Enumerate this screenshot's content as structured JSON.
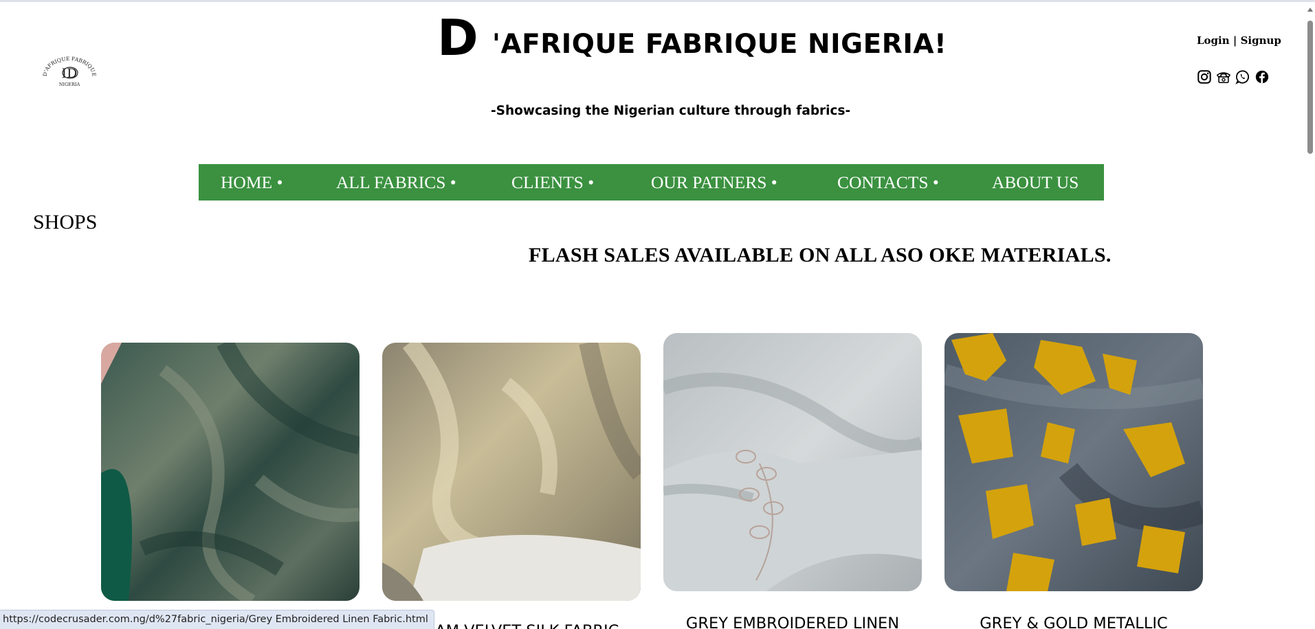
{
  "brand": {
    "initial": "D",
    "name": "'AFRIQUE FABRIQUE NIGERIA!",
    "tagline": "-Showcasing the Nigerian culture through fabrics-",
    "logo_text_top": "D'AFRIQUE FABRIQUE",
    "logo_text_bottom": "NIGERIA"
  },
  "auth": {
    "login": "Login",
    "separator": " | ",
    "signup": "Signup"
  },
  "socials": [
    {
      "icon": "instagram-icon"
    },
    {
      "icon": "telephone-icon"
    },
    {
      "icon": "whatsapp-icon"
    },
    {
      "icon": "facebook-icon"
    }
  ],
  "nav": {
    "background": "#3b9140",
    "items": [
      "HOME •",
      "ALL FABRICS •",
      "CLIENTS •",
      "OUR PATNERS •",
      "CONTACTS •",
      "ABOUT US"
    ]
  },
  "shops_heading": "SHOPS",
  "flash_banner": "FLASH SALES AVAILABLE ON ALL ASO OKE MATERIALS.",
  "products": [
    {
      "caption": "",
      "image": "green shimmer fabric"
    },
    {
      "caption": "CREAM VELVET SILK FABRIC",
      "image": "cream silk fabric"
    },
    {
      "caption": "GREY EMBROIDERED LINEN",
      "image": "grey embroidered linen fabric"
    },
    {
      "caption": "GREY & GOLD METALLIC",
      "image": "grey and gold metallic fabric"
    }
  ],
  "status_url": "https://codecrusader.com.ng/d%27fabric_nigeria/Grey Embroidered Linen Fabric.html"
}
